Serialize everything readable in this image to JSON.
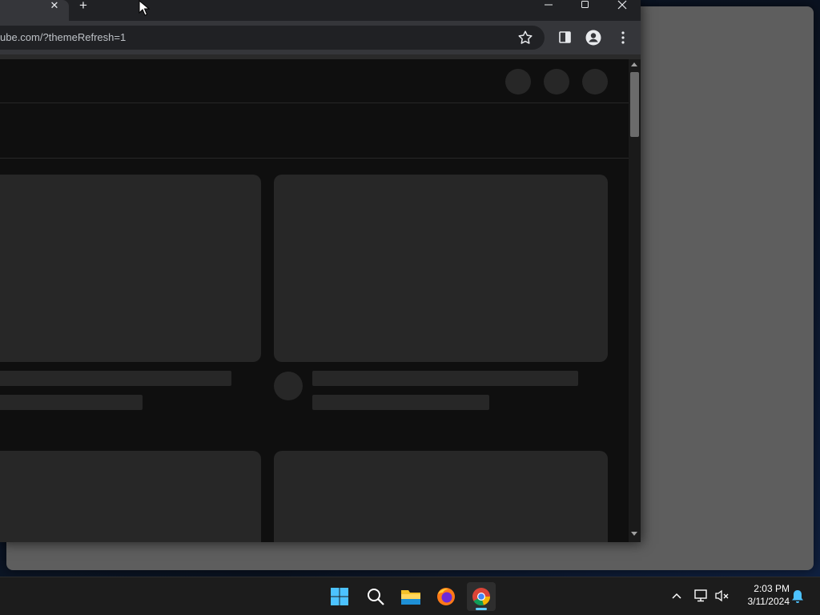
{
  "browser": {
    "tab_close_glyph": "✕",
    "new_tab_glyph": "+",
    "window_controls": {
      "minimize": "—",
      "maximize": "☐",
      "close": "✕"
    },
    "url": "ube.com/?themeRefresh=1",
    "toolbar_icons": [
      "star-icon",
      "side-panel-icon",
      "profile-icon",
      "menu-icon"
    ]
  },
  "page": {
    "theme": "dark",
    "background": "#0f0f0f",
    "placeholder_color": "#272727",
    "masthead_circles": 3,
    "video_cards": 4
  },
  "taskbar": {
    "apps": [
      "start-icon",
      "search-icon",
      "file-explorer-icon",
      "firefox-icon",
      "chrome-icon"
    ],
    "active_app": "chrome",
    "accent": "#60cdff",
    "tray_chevron": "^",
    "clock": {
      "time": "2:03 PM",
      "date": "3/11/2024"
    }
  }
}
